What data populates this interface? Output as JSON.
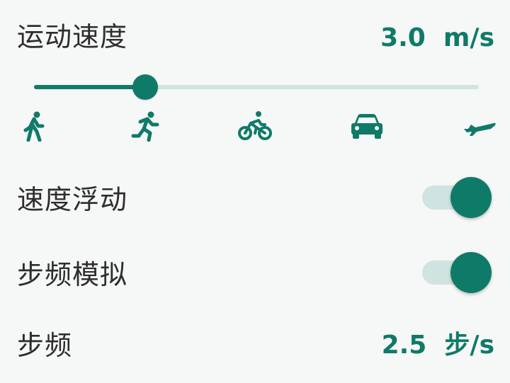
{
  "speed": {
    "label": "运动速度",
    "value": "3.0  m/s",
    "slider_fraction": 0.25
  },
  "modes": [
    {
      "icon": "walk-icon"
    },
    {
      "icon": "run-icon"
    },
    {
      "icon": "bike-icon"
    },
    {
      "icon": "car-icon"
    },
    {
      "icon": "plane-icon"
    }
  ],
  "speed_float": {
    "label": "速度浮动",
    "enabled": true
  },
  "step_sim": {
    "label": "步频模拟",
    "enabled": true
  },
  "step_freq": {
    "label": "步频",
    "value": "2.5  步/s"
  },
  "colors": {
    "accent": "#0f7a68",
    "track": "#cfe5e1",
    "text": "#2d2d2d",
    "background": "#f6f7f7"
  }
}
